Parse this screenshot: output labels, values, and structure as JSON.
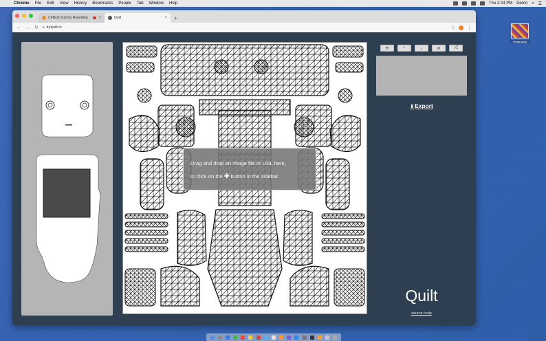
{
  "menubar": {
    "app": "Chrome",
    "items": [
      "File",
      "Edit",
      "View",
      "History",
      "Bookmarks",
      "People",
      "Tab",
      "Window",
      "Help"
    ],
    "clock": "Thu 2:24 PM",
    "user": "Demo"
  },
  "desktop": {
    "file_name": "image.jpeg"
  },
  "browser": {
    "tabs": [
      {
        "title": "CFBest Yummy Roundtop"
      },
      {
        "title": "Quilt"
      }
    ],
    "new_tab": "+",
    "url": "tryquilt.io"
  },
  "canvas": {
    "overlay_line1": "Drag and drop an image file or URL here,",
    "overlay_line2_pre": "or click on the",
    "overlay_plus": "✚",
    "overlay_line2_post": "button in the sidebar."
  },
  "sidebar": {
    "tools": [
      {
        "icon": "crosshair-icon",
        "glyph": "✣"
      },
      {
        "icon": "chevron-up-icon",
        "glyph": "⌃"
      },
      {
        "icon": "chevron-down-icon",
        "glyph": "⌄"
      },
      {
        "icon": "eye-slash-icon",
        "glyph": "⊘"
      },
      {
        "icon": "shuffle-icon",
        "glyph": "⤮"
      }
    ],
    "export_label": "Export",
    "brand": "Quilt",
    "source_link": "source code"
  },
  "colors": {
    "page_bg": "#2d3f51",
    "panel_gray": "#b9b9b9"
  }
}
